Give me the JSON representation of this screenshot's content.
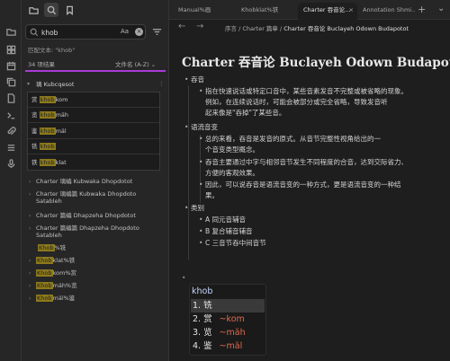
{
  "ribbon": [
    "folder-icon",
    "grid-icon",
    "calendar-icon",
    "copy-icon",
    "file-icon",
    "terminal-icon",
    "attachment-icon",
    "list-icon",
    "mic-icon"
  ],
  "search": {
    "query": "khob",
    "case_label": "Aa",
    "clear": "×",
    "match_hint": "匹配文本: \"khob\"",
    "count": "34 项结果",
    "sort": "文件名 (A-Z) ⌄"
  },
  "results": {
    "first_group": "璃 Kubcqesot",
    "first_group_dots": "⋮",
    "match_lines": [
      {
        "pre": "赏 ",
        "hit": "khob",
        "post": "kom"
      },
      {
        "pre": "览 ",
        "hit": "khob",
        "post": "mäh"
      },
      {
        "pre": "鉴 ",
        "hit": "khob",
        "post": "mäl"
      },
      {
        "pre": "铣 ",
        "hit": "khob",
        "post": ""
      },
      {
        "pre": "铁 ",
        "hit": "khob",
        "post": "klat"
      }
    ],
    "rows": [
      {
        "text": "Charter 璃编 Kubwaka Dhopdotot",
        "pre": "",
        "hit": "",
        "post": ""
      },
      {
        "text": "Charter 璃编篇 Kubwaka Dhopdoto",
        "pre": "",
        "hit": "",
        "post": ""
      },
      {
        "text": "Satableh",
        "pre": "",
        "hit": "",
        "post": ""
      },
      {
        "text": "Charter 篇编 Dhapzeha Dhopdotot",
        "pre": "",
        "hit": "",
        "post": ""
      },
      {
        "text": "Charter 篇编篇 Dhapzeha Dhopdoto",
        "pre": "",
        "hit": "",
        "post": ""
      },
      {
        "text": "Satableh",
        "pre": "",
        "hit": "",
        "post": ""
      }
    ],
    "file_rows": [
      {
        "pre": "",
        "hit": "Khob",
        "post": "%铣"
      },
      {
        "pre": "",
        "hit": "Khob",
        "post": "klat%铁"
      },
      {
        "pre": "",
        "hit": "Khob",
        "post": "kom%赏"
      },
      {
        "pre": "",
        "hit": "Khob",
        "post": "mäh%览"
      },
      {
        "pre": "",
        "hit": "Khob",
        "post": "mäl%鉴"
      }
    ],
    "row_dots": "⋮"
  },
  "tabs": [
    {
      "label": "Manual%画"
    },
    {
      "label": "Khobklat%铁"
    },
    {
      "label": "Charter 吞音论..."
    },
    {
      "label": "Annotation Shmi..."
    }
  ],
  "tab_close": "×",
  "tab_plus": "+",
  "tab_menu": "⌄",
  "nav": {
    "back": "←",
    "forward": "→"
  },
  "breadcrumb": {
    "a": "序言",
    "sep1": " / ",
    "b": "Charter 篇章",
    "sep2": " / ",
    "c": "Charter 吞音论 Buclayeh Odown Budapotot"
  },
  "doc": {
    "title": "Charter 吞音论 Buclayeh Odown Budapotot",
    "s1": "吞音",
    "s1_lines": [
      "指在快速说话或特定口音中，某些音素发音不完整或被省略的现象。",
      "例如，在连续说话时，可能会被部分或完全省略，导致发音听",
      "起来像是\"吞掉\"了某些音。"
    ],
    "s2": "语流音变",
    "s2_items": [
      [
        "总的来看，吞音是发音的原式。从音节完整性视角给出的一",
        "个音变类型概念。"
      ],
      [
        "吞音主要通过中字与相邻音节发生不同程度的合音，达到交际省力、",
        "方便的客观效果。"
      ],
      [
        "因此，可以说吞音是语流音变的一种方式，更是语流音变的一种结",
        "果。"
      ]
    ],
    "s3": "类别",
    "s3_items": [
      "A 同元音辅音",
      "B 复合辅音辅音",
      "C 三音节吞中间音节"
    ]
  },
  "suggest": {
    "query": "khob",
    "items": [
      {
        "n": "1. 铣",
        "py": ""
      },
      {
        "n": "2. 赏",
        "py": "~kom"
      },
      {
        "n": "3. 览",
        "py": "~mäh"
      },
      {
        "n": "4. 鉴",
        "py": "~mäl"
      }
    ]
  },
  "colors": {
    "accent": "#a73bd6",
    "highlight": "#8c7a1d",
    "pinyin": "#e26a4d"
  }
}
